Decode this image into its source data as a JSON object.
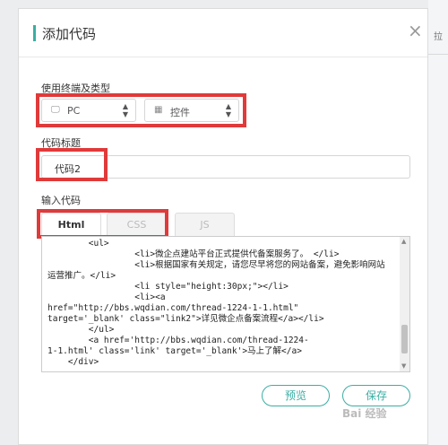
{
  "background": {
    "right_text": "拉"
  },
  "dialog": {
    "title": "添加代码",
    "close_icon": "×",
    "usage_section": {
      "label": "使用终端及类型",
      "device_select": {
        "icon": "monitor-icon",
        "value": "PC"
      },
      "type_select": {
        "icon": "grid-icon",
        "value": "控件"
      }
    },
    "code_title_section": {
      "label": "代码标题",
      "value": "代码2"
    },
    "code_input_section": {
      "label": "输入代码",
      "tabs": [
        {
          "label": "Html",
          "active": true
        },
        {
          "label": "CSS",
          "active": false
        },
        {
          "label": "JS",
          "active": false
        }
      ],
      "code": "        <ul>\n                 <li>微企点建站平台正式提供代备案服务了。 </li>\n                 <li>根据国家有关规定，请您尽早将您的网站备案，避免影响网站运营推广。</li>\n                 <li style=\"height:30px;\"></li>\n                 <li><a\nhref=\"http://bbs.wqdian.com/thread-1224-1-1.html\"\ntarget='_blank' class=\"link2\">详见微企点备案流程</a></li>\n        </ul>\n        <a href='http://bbs.wqdian.com/thread-1224-\n1-1.html' class='link' target='_blank'>马上了解</a>\n    </div>"
    },
    "buttons": {
      "preview": "预览",
      "save": "保存"
    }
  },
  "watermark": "Bai 经验",
  "colors": {
    "accent": "#3aaea3",
    "highlight": "#e03a3a"
  }
}
